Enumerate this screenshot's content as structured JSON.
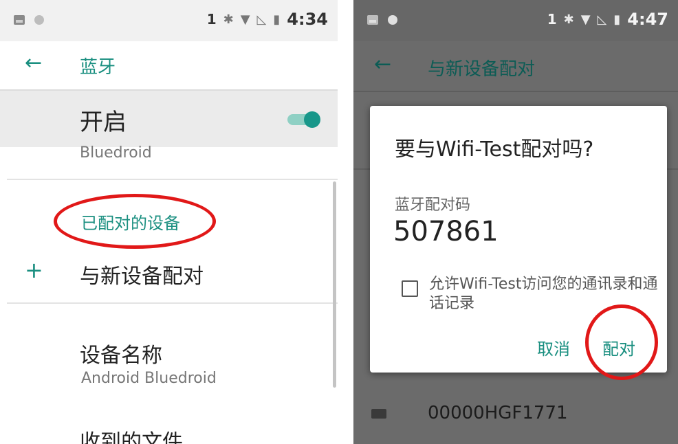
{
  "left": {
    "status": {
      "sim": "1",
      "time": "4:34"
    },
    "title": "蓝牙",
    "toggle_label": "开启",
    "toggle_sub": "Bluedroid",
    "toggle_on": true,
    "section_title": "已配对的设备",
    "pair_new": "与新设备配对",
    "device_name_label": "设备名称",
    "device_name_value": "Android Bluedroid",
    "received_files": "收到的文件"
  },
  "right": {
    "status": {
      "sim": "1",
      "time": "4:47"
    },
    "title": "与新设备配对",
    "bg_device": "00000HGF1771",
    "dialog": {
      "title": "要与Wifi-Test配对吗?",
      "code_label": "蓝牙配对码",
      "code": "507861",
      "checkbox_text": "允许Wifi-Test访问您的通讯录和通话记录",
      "cancel": "取消",
      "pair": "配对"
    }
  },
  "annotation_color": "#e11818",
  "accent_color": "#1a8f80"
}
